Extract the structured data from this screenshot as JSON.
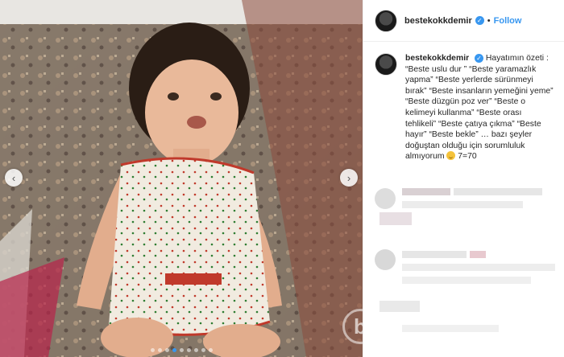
{
  "post": {
    "username": "bestekokkdemir",
    "follow_label": "Follow",
    "separator": "•",
    "caption": "Hayatımın özeti : “Beste uslu dur ” “Beste yaramazlık yapma” “Beste yerlerde sürünmeyi bırak” “Beste insanların yemeğini yeme” “Beste düzgün poz ver” “Beste o kelimeyi kullanma” “Beste orası tehlikeli” “Beste çatıya çıkma” “Beste hayır” “Beste bekle” … bazı şeyler doğuştan olduğu için sorumluluk almıyorum",
    "caption_tail": "7=70"
  },
  "carousel": {
    "prev_icon": "‹",
    "next_icon": "›",
    "dot_count": 9,
    "active_dot": 3
  },
  "icons": {
    "verified": "✓",
    "watermark": "b"
  },
  "colors": {
    "accent": "#3897f0",
    "text": "#262626",
    "border": "#efefef"
  }
}
